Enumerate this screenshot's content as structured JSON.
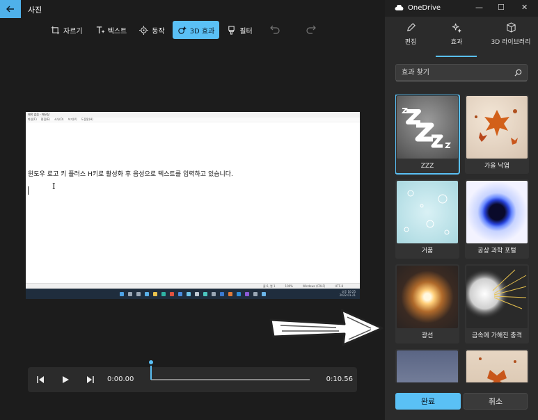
{
  "app": {
    "title": "사진"
  },
  "toolbar": {
    "items": [
      {
        "label": "자르기",
        "icon": "crop-icon"
      },
      {
        "label": "텍스트",
        "icon": "text-icon"
      },
      {
        "label": "동작",
        "icon": "motion-icon"
      },
      {
        "label": "3D 효과",
        "icon": "3d-effects-icon",
        "active": true
      },
      {
        "label": "필터",
        "icon": "filter-icon"
      }
    ]
  },
  "preview": {
    "window_title": "제목 없음 - 메모장",
    "menu": [
      "파일(F)",
      "편집(E)",
      "서식(O)",
      "보기(V)",
      "도움말(H)"
    ],
    "text": "윈도우 로고 키 플러스 H키로 활성화 후 음성으로 텍스트를 입력하고 있습니다.",
    "status": [
      "줄 6, 열 1",
      "100%",
      "Windows (CRLF)",
      "UTF-8"
    ],
    "clock_time": "오후 10:25",
    "clock_date": "2022-01-21"
  },
  "player": {
    "current_time": "0:00.00",
    "end_time": "0:10.56",
    "progress": 0.0
  },
  "onedrive": {
    "label": "OneDrive"
  },
  "panel": {
    "tabs": [
      {
        "label": "편집",
        "icon": "pencil-icon"
      },
      {
        "label": "효과",
        "icon": "sparkle-icon",
        "active": true
      },
      {
        "label": "3D 라이브러리",
        "icon": "cube-icon"
      }
    ],
    "search_placeholder": "효과 찾기",
    "effects": [
      {
        "label": "ZZZ",
        "selected": true
      },
      {
        "label": "가을 낙엽"
      },
      {
        "label": "거품"
      },
      {
        "label": "공상 과학 포털"
      },
      {
        "label": "광선"
      },
      {
        "label": "금속에 가해진 충격"
      },
      {
        "label": ""
      },
      {
        "label": ""
      }
    ],
    "done_label": "완료",
    "cancel_label": "취소"
  },
  "colors": {
    "accent": "#5ac0f5",
    "panel_bg": "#2b2b2b",
    "main_bg": "#1c1c1c"
  }
}
